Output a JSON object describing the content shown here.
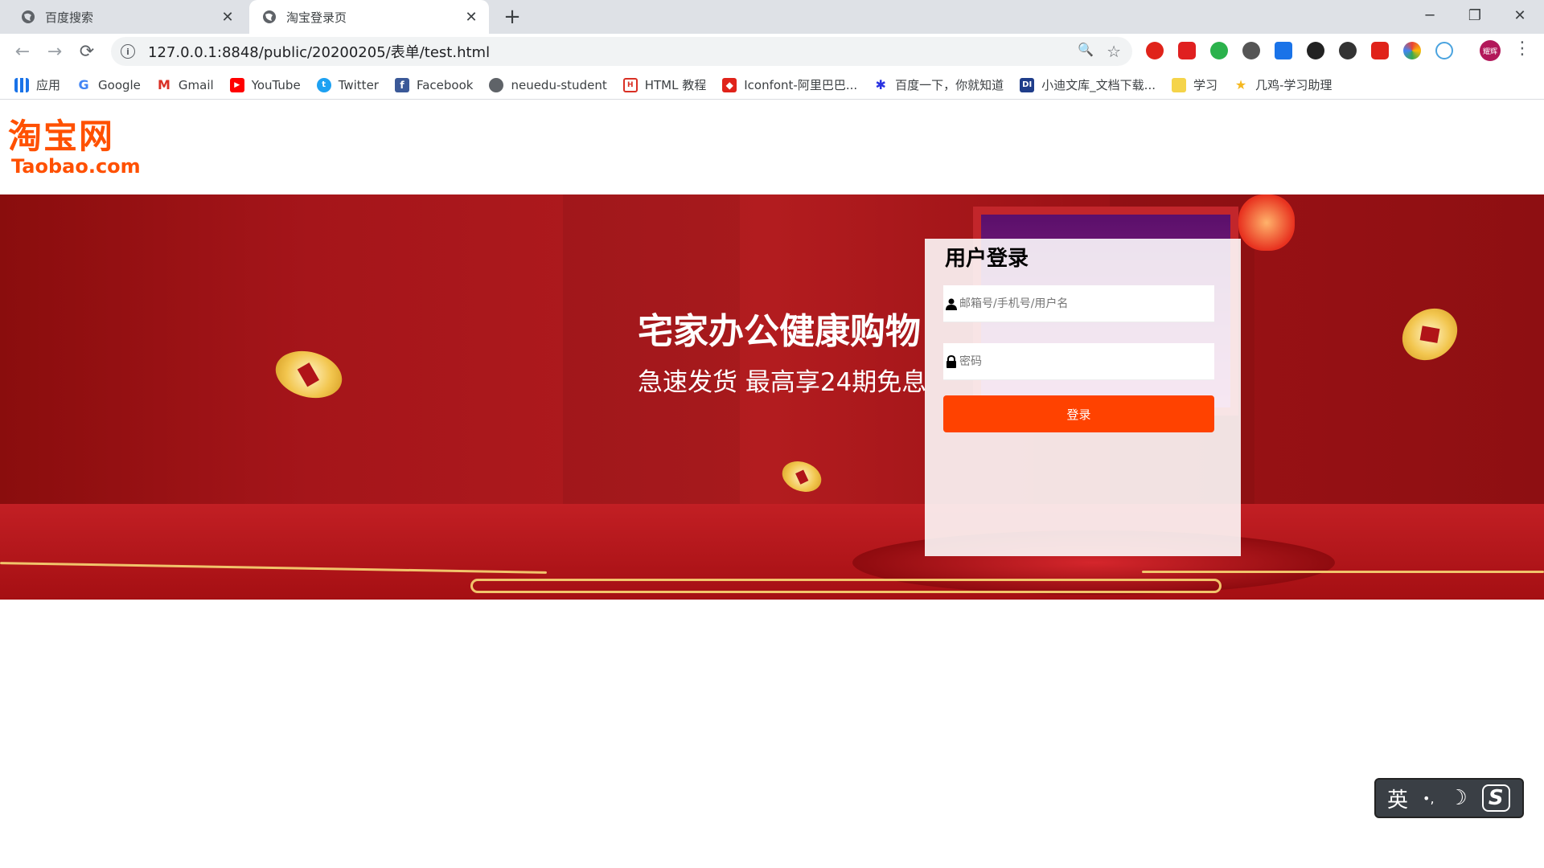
{
  "browser": {
    "tabs": [
      {
        "title": "百度搜索",
        "active": false
      },
      {
        "title": "淘宝登录页",
        "active": true
      }
    ],
    "new_tab_symbol": "+",
    "close_symbol": "✕",
    "window_controls": {
      "minimize": "─",
      "maximize": "❐",
      "close": "✕"
    },
    "nav": {
      "back": "←",
      "forward": "→",
      "reload": "⟳"
    },
    "url": "127.0.0.1:8848/public/20200205/表单/test.html",
    "info_symbol": "i",
    "zoom_icon": "🔍",
    "star_icon": "☆",
    "extensions": [
      {
        "name": "adblock-icon",
        "color": "#e0231a"
      },
      {
        "name": "youtube-ext-icon",
        "color": "#e02020"
      },
      {
        "name": "audio-ext-icon",
        "color": "#2bb24c"
      },
      {
        "name": "wechat-ext-icon",
        "color": "#555555"
      },
      {
        "name": "share-ext-icon",
        "color": "#1a73e8"
      },
      {
        "name": "dark-ext-icon",
        "color": "#222222"
      },
      {
        "name": "sync-ext-icon",
        "color": "#333333"
      },
      {
        "name": "translate-ext-icon",
        "color": "#e0231a"
      },
      {
        "name": "color-ext-icon",
        "color": "#f4b400"
      },
      {
        "name": "infinity-ext-icon",
        "color": "#4aa3df"
      }
    ],
    "profile_label": "耀辉",
    "menu_symbol": "⋮",
    "bookmarks": [
      {
        "label": "应用",
        "icon": "apps-grid-icon",
        "color": "#1a73e8"
      },
      {
        "label": "Google",
        "icon": "google-icon",
        "color": "#4285f4"
      },
      {
        "label": "Gmail",
        "icon": "gmail-icon",
        "color": "#d93025"
      },
      {
        "label": "YouTube",
        "icon": "youtube-icon",
        "color": "#ff0000"
      },
      {
        "label": "Twitter",
        "icon": "twitter-icon",
        "color": "#1da1f2"
      },
      {
        "label": "Facebook",
        "icon": "facebook-icon",
        "color": "#3b5998"
      },
      {
        "label": "neuedu-student",
        "icon": "globe-icon",
        "color": "#5f6368"
      },
      {
        "label": "HTML 教程",
        "icon": "html-icon",
        "color": "#d93025"
      },
      {
        "label": "Iconfont-阿里巴巴...",
        "icon": "iconfont-icon",
        "color": "#e0231a"
      },
      {
        "label": "百度一下，你就知道",
        "icon": "baidu-icon",
        "color": "#2932e1"
      },
      {
        "label": "小迪文库_文档下载...",
        "icon": "di-icon",
        "color": "#1f3d8a"
      },
      {
        "label": "学习",
        "icon": "folder-icon",
        "color": "#f5d44a"
      },
      {
        "label": "几鸡-学习助理",
        "icon": "chick-icon",
        "color": "#f5b820"
      }
    ]
  },
  "page": {
    "logo": {
      "cn": "淘宝网",
      "en": "Taobao.com"
    },
    "banner": {
      "headline": "宅家办公健康购物",
      "subline": "急速发货 最高享24期免息"
    },
    "login": {
      "title": "用户登录",
      "username_placeholder": "邮箱号/手机号/用户名",
      "password_placeholder": "密码",
      "submit_label": "登录"
    }
  },
  "ime": {
    "mode": "英",
    "punct": "•,",
    "moon": "☽",
    "logo": "S"
  }
}
